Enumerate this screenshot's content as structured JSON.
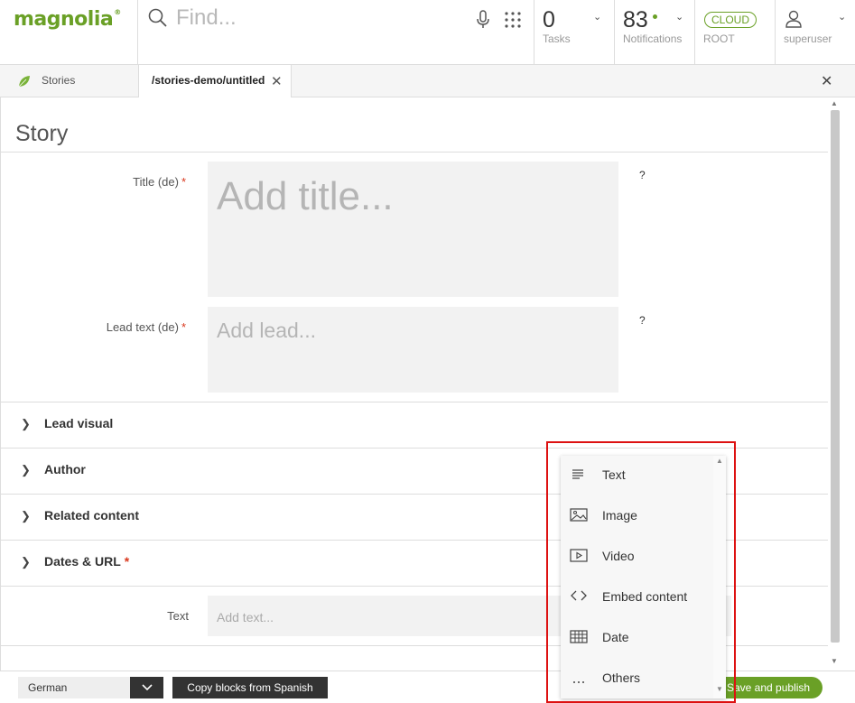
{
  "brand": {
    "logo": "magnolia",
    "logo_mark": "®"
  },
  "search": {
    "placeholder": "Find..."
  },
  "tasks": {
    "count": "0",
    "label": "Tasks"
  },
  "notifications": {
    "count": "83",
    "label": "Notifications"
  },
  "environment": {
    "badge": "CLOUD",
    "label": "ROOT"
  },
  "user": {
    "name": "superuser"
  },
  "tabs": [
    {
      "label": "Stories"
    },
    {
      "label": "/stories-demo/untitled"
    }
  ],
  "form": {
    "heading": "Story",
    "fields": [
      {
        "label": "Title (de)",
        "required": "*",
        "placeholder": "Add title...",
        "help": "?"
      },
      {
        "label": "Lead text (de)",
        "required": "*",
        "placeholder": "Add lead...",
        "help": "?"
      }
    ],
    "sections": [
      {
        "label": "Lead visual"
      },
      {
        "label": "Author"
      },
      {
        "label": "Related content"
      },
      {
        "label": "Dates & URL",
        "required": "*"
      }
    ],
    "text_block": {
      "label": "Text",
      "placeholder": "Add text..."
    }
  },
  "footer": {
    "language": "German",
    "copy_button": "Copy blocks from Spanish",
    "save_button": "Save and publish"
  },
  "block_menu": {
    "items": [
      {
        "label": "Text",
        "icon": "text-lines-icon"
      },
      {
        "label": "Image",
        "icon": "image-icon"
      },
      {
        "label": "Video",
        "icon": "video-icon"
      },
      {
        "label": "Embed content",
        "icon": "code-icon"
      },
      {
        "label": "Date",
        "icon": "calendar-grid-icon"
      },
      {
        "label": "Others",
        "icon": "ellipsis-icon"
      }
    ]
  },
  "colors": {
    "brand": "#6aa026",
    "required": "#d9381e",
    "highlight": "#dd1111"
  }
}
